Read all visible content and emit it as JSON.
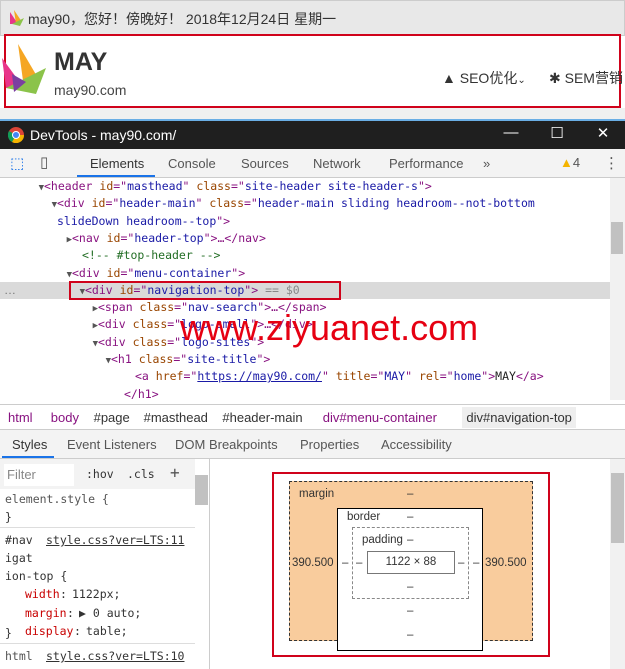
{
  "page": {
    "greeting": "may90，您好！傍晚好！ 2018年12月24日 星期一",
    "brand": "MAY",
    "domain": "may90.com",
    "nav": [
      "SEO优化",
      "SEM营销"
    ]
  },
  "devtools": {
    "title": "DevTools - may90.com/",
    "tabs": [
      "Elements",
      "Console",
      "Sources",
      "Network",
      "Performance",
      "»"
    ],
    "warnings": "4",
    "tree": [
      {
        "indent": 44,
        "arrow": "▼",
        "parts": [
          [
            "tg",
            "<header "
          ],
          [
            "an",
            "id"
          ],
          [
            "tg",
            "=\""
          ],
          [
            "av",
            "masthead"
          ],
          [
            "tg",
            "\" "
          ],
          [
            "an",
            "class"
          ],
          [
            "tg",
            "=\""
          ],
          [
            "av",
            "site-header site-header-s"
          ],
          [
            "tg",
            "\">"
          ]
        ]
      },
      {
        "indent": 57,
        "arrow": "▼",
        "parts": [
          [
            "tg",
            "<div "
          ],
          [
            "an",
            "id"
          ],
          [
            "tg",
            "=\""
          ],
          [
            "av",
            "header-main"
          ],
          [
            "tg",
            "\" "
          ],
          [
            "an",
            "class"
          ],
          [
            "tg",
            "=\""
          ],
          [
            "av",
            "header-main sliding headroom--not-bottom"
          ]
        ]
      },
      {
        "indent": 57,
        "arrow": "",
        "parts": [
          [
            "av",
            "slideDown headroom--top"
          ],
          [
            "tg",
            "\">"
          ]
        ]
      },
      {
        "indent": 72,
        "arrow": "▶",
        "parts": [
          [
            "tg",
            "<nav "
          ],
          [
            "an",
            "id"
          ],
          [
            "tg",
            "=\""
          ],
          [
            "av",
            "header-top"
          ],
          [
            "tg",
            "\">…</nav>"
          ]
        ]
      },
      {
        "indent": 82,
        "arrow": "",
        "parts": [
          [
            "cm",
            "<!-- #top-header -->"
          ]
        ]
      },
      {
        "indent": 72,
        "arrow": "▼",
        "parts": [
          [
            "tg",
            "<div "
          ],
          [
            "an",
            "id"
          ],
          [
            "tg",
            "=\""
          ],
          [
            "av",
            "menu-container"
          ],
          [
            "tg",
            "\">"
          ]
        ]
      },
      {
        "indent": 85,
        "arrow": "▼",
        "sel": true,
        "parts": [
          [
            "tg",
            "<div "
          ],
          [
            "an",
            "id"
          ],
          [
            "tg",
            "=\""
          ],
          [
            "av",
            "navigation-top"
          ],
          [
            "tg",
            "\">"
          ],
          [
            "dim",
            " == $0"
          ]
        ]
      },
      {
        "indent": 98,
        "arrow": "▶",
        "parts": [
          [
            "tg",
            "<span "
          ],
          [
            "an",
            "class"
          ],
          [
            "tg",
            "=\""
          ],
          [
            "av",
            "nav-search"
          ],
          [
            "tg",
            "\">…</span>"
          ]
        ]
      },
      {
        "indent": 98,
        "arrow": "▶",
        "parts": [
          [
            "tg",
            "<div "
          ],
          [
            "an",
            "class"
          ],
          [
            "tg",
            "=\""
          ],
          [
            "av",
            "logo-small"
          ],
          [
            "tg",
            "\">…</div>"
          ]
        ]
      },
      {
        "indent": 98,
        "arrow": "▼",
        "parts": [
          [
            "tg",
            "<div "
          ],
          [
            "an",
            "class"
          ],
          [
            "tg",
            "=\""
          ],
          [
            "av",
            "logo-sites"
          ],
          [
            "tg",
            "\">"
          ]
        ]
      },
      {
        "indent": 111,
        "arrow": "▼",
        "parts": [
          [
            "tg",
            "<h1 "
          ],
          [
            "an",
            "class"
          ],
          [
            "tg",
            "=\""
          ],
          [
            "av",
            "site-title"
          ],
          [
            "tg",
            "\">"
          ]
        ]
      },
      {
        "indent": 135,
        "arrow": "",
        "parts": [
          [
            "tg",
            "<a "
          ],
          [
            "an",
            "href"
          ],
          [
            "tg",
            "=\""
          ],
          [
            "lk",
            "https://may90.com/"
          ],
          [
            "tg",
            "\" "
          ],
          [
            "an",
            "title"
          ],
          [
            "tg",
            "=\""
          ],
          [
            "av",
            "MAY"
          ],
          [
            "tg",
            "\" "
          ],
          [
            "an",
            "rel"
          ],
          [
            "tg",
            "=\""
          ],
          [
            "av",
            "home"
          ],
          [
            "tg",
            "\">"
          ],
          [
            "pl",
            "MAY"
          ],
          [
            "tg",
            "</a>"
          ]
        ]
      },
      {
        "indent": 124,
        "arrow": "",
        "parts": [
          [
            "tg",
            "</h1>"
          ]
        ]
      }
    ],
    "watermark": "www.ziyuanet.com",
    "breadcrumbs": [
      "html",
      "body",
      "#page",
      "#masthead",
      "#header-main",
      "div#menu-container",
      "div#navigation-top"
    ],
    "subtabs": [
      "Styles",
      "Event Listeners",
      "DOM Breakpoints",
      "Properties",
      "Accessibility"
    ],
    "styles": {
      "filter_placeholder": "Filter",
      "hov": ":hov",
      "cls": ".cls",
      "add": "+",
      "element_style": "element.style {",
      "close": "}",
      "rule_selector": [
        "#nav",
        "igat",
        "ion-top {"
      ],
      "rule_source": "style.css?ver=LTS:11",
      "decls": [
        {
          "p": "width",
          "v": "1122px;"
        },
        {
          "p": "margin",
          "v": "▶ 0 auto;"
        },
        {
          "p": "display",
          "v": "table;"
        }
      ],
      "next_selector": "html",
      "next_source": "style.css?ver=LTS:10"
    },
    "box_model": {
      "margin_label": "margin",
      "border_label": "border",
      "padding_label": "padding",
      "content": "1122 × 88",
      "margin_left": "390.500",
      "margin_right": "390.500",
      "dash": "–"
    }
  }
}
